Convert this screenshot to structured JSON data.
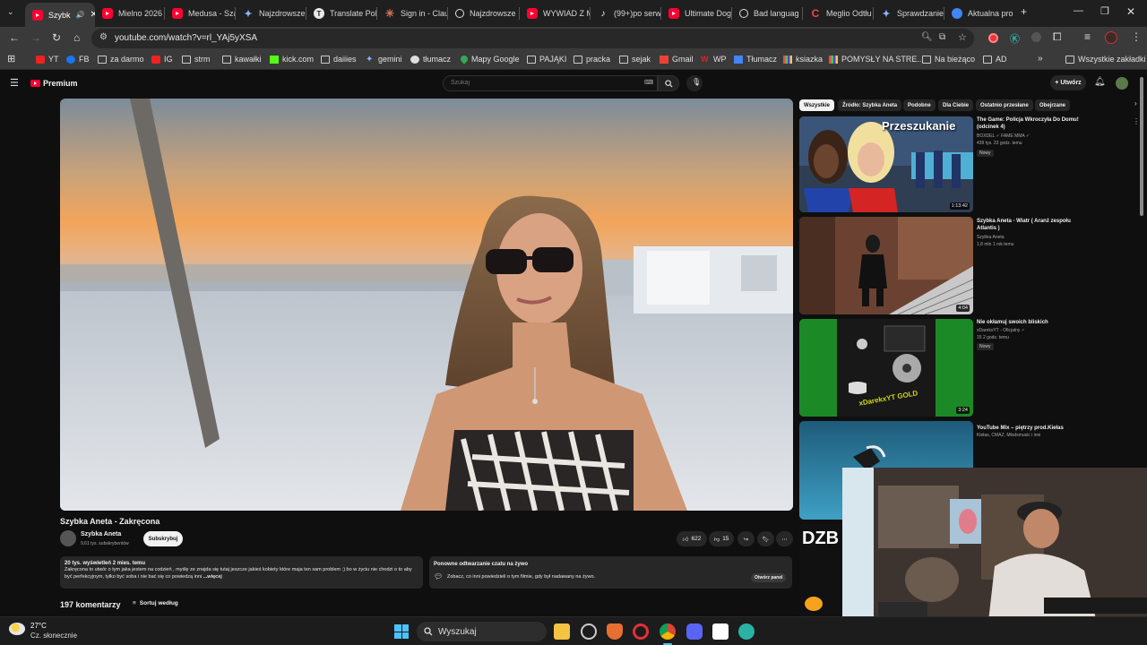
{
  "browser": {
    "tabs": [
      {
        "title": "Szybk",
        "icon": "youtube-icon",
        "active": true
      },
      {
        "title": "Mielno 2026",
        "icon": "youtube-icon"
      },
      {
        "title": "Medusa - Sza",
        "icon": "youtube-icon"
      },
      {
        "title": "Najzdrowsze",
        "icon": "gemini-icon"
      },
      {
        "title": "Translate Poli",
        "icon": "translate-icon"
      },
      {
        "title": "Sign in - Clau",
        "icon": "claude-icon"
      },
      {
        "title": "Najzdrowsze",
        "icon": "chatgpt-icon"
      },
      {
        "title": "WYWIAD Z M",
        "icon": "youtube-icon"
      },
      {
        "title": "(99+)po serw",
        "icon": "tiktok-icon"
      },
      {
        "title": "Ultimate Dog",
        "icon": "youtube-icon"
      },
      {
        "title": "Bad languag",
        "icon": "chatgpt-icon"
      },
      {
        "title": "Meglio Odtłu",
        "icon": "c-icon"
      },
      {
        "title": "Sprawdzanie",
        "icon": "gemini-icon"
      },
      {
        "title": "Aktualna pro",
        "icon": "chrome-icon"
      }
    ],
    "url": "youtube.com/watch?v=rl_YAj5yXSA",
    "bookmarks": [
      {
        "label": "YT",
        "icon": "red"
      },
      {
        "label": "FB",
        "icon": "blue"
      },
      {
        "label": "za darmo",
        "icon": "folder"
      },
      {
        "label": "IG",
        "icon": "red"
      },
      {
        "label": "strm",
        "icon": "folder"
      },
      {
        "label": "kawałki",
        "icon": "folder"
      },
      {
        "label": "kick.com",
        "icon": "green"
      },
      {
        "label": "daiiies",
        "icon": "folder"
      },
      {
        "label": "gemini",
        "icon": "star"
      },
      {
        "label": "tłumacz",
        "icon": "gray"
      },
      {
        "label": "Mapy Google",
        "icon": "map"
      },
      {
        "label": "PAJĄKI",
        "icon": "folder"
      },
      {
        "label": "pracka",
        "icon": "folder"
      },
      {
        "label": "sejak",
        "icon": "folder"
      },
      {
        "label": "Gmail",
        "icon": "gm"
      },
      {
        "label": "WP",
        "icon": "wp"
      },
      {
        "label": "Tłumacz",
        "icon": "tl"
      },
      {
        "label": "ksiazka",
        "icon": "mlt"
      },
      {
        "label": "POMYSŁY NA STRE...",
        "icon": "mlt"
      },
      {
        "label": "Na bieżąco",
        "icon": "folder"
      },
      {
        "label": "AD",
        "icon": "folder"
      }
    ],
    "all_bookmarks": "Wszystkie zakładki"
  },
  "youtube": {
    "logo": "Premium",
    "search_placeholder": "Szukaj",
    "create_label": "Utwórz",
    "video": {
      "title": "Szybka Aneta - Zakręcona",
      "channel": "Szybka Aneta",
      "subscribers": "9,61 tys. subskrybentów",
      "subscribe_label": "Subskrybuj",
      "likes": "622",
      "dislikes": "15",
      "views_meta": "20 tys. wyświetleń  2 mies. temu",
      "description": "Zakręcona to utwór o tym jaka jestem na codzień , myślę ze znajda się tutaj jeszcze jakieś  kobiety które maja ten sam problem ;) bo w życiu nie chodzi o to aby być perfekcyjnym, tylko być soba i nie bać się co powiedzą inni",
      "more_label": "...więcej",
      "live_title": "Ponowne odtwarzanie czatu na żywo",
      "live_text": "Zobacz, co inni powiedzieli o tym filmie, gdy był nadawany na żywo.",
      "live_button": "Otwórz panel",
      "comments_count": "197 komentarzy",
      "sort_label": "Sortuj według"
    },
    "chips": [
      "Wszystkie",
      "Źródło: Szybka Aneta",
      "Podobne",
      "Dla Ciebie",
      "Ostatnio przesłane",
      "Obejrzane"
    ],
    "recommendations": [
      {
        "title": "The Game: Policja Wkroczyła Do Domu! (odcinek 4)",
        "channel": "BOXDEL ✓ FAME MMA ✓",
        "meta": "439 tys.  23 godz. temu",
        "badge": "Nowy",
        "duration": "1:13:42",
        "thumb_text": "Przeszukanie"
      },
      {
        "title": "Szybka Aneta - Wiatr ( Aranż zespołu Atlantis )",
        "channel": "Szybka Aneta",
        "meta": "1,8 mln  1 rok temu",
        "badge": "",
        "duration": "4:04"
      },
      {
        "title": "Nie okłamuj swoich bliskich",
        "channel": "xDarekxYT - Oficjalny ✓",
        "meta": "15  2 godz. temu",
        "badge": "Nowy",
        "duration": "3:24",
        "thumb_text": "xDarekxYT GOLD"
      },
      {
        "title": "YouTube Mix – piętrzy prod.Kiełas",
        "channel": "Kiełas, CMAZ, Młodsmusic i inni",
        "meta": "",
        "badge": "",
        "duration": ""
      }
    ],
    "partial_thumb_text": "DZB"
  },
  "taskbar": {
    "temperature": "27°C",
    "weather": "Cz. słonecznie",
    "search_label": "Wyszukaj"
  }
}
